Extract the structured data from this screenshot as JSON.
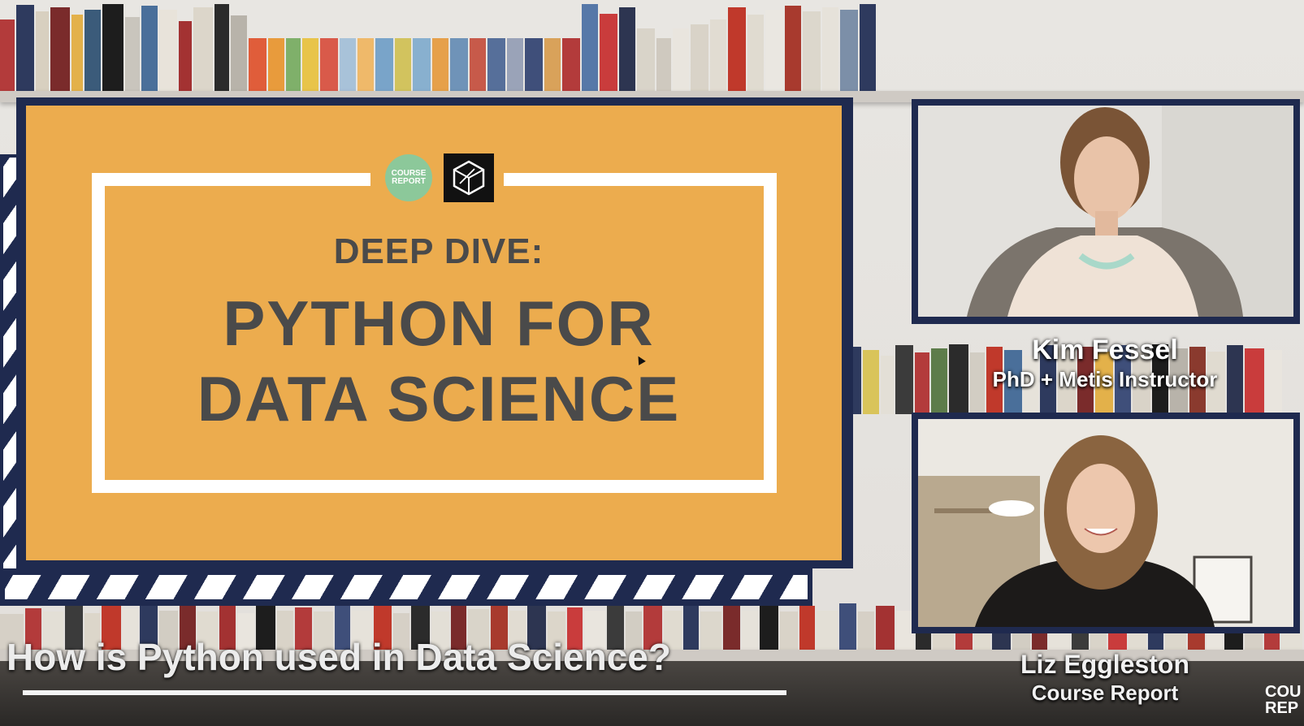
{
  "slide": {
    "logo_course_report": "COURSE REPORT",
    "line1": "DEEP DIVE:",
    "line2": "PYTHON FOR",
    "line3": "DATA SCIENCE"
  },
  "speakers": [
    {
      "name": "Kim Fessel",
      "role": "PhD + Metis Instructor"
    },
    {
      "name": "Liz Eggleston",
      "role": "Course Report"
    }
  ],
  "caption": {
    "question": "How is Python used in Data Science?"
  },
  "corner_logo": {
    "line1": "COU",
    "line2": "REP"
  },
  "colors": {
    "slide_bg": "#ecac4e",
    "navy": "#1f2a4f",
    "text_gray": "#4a4a4a",
    "logo_green": "#8cc89a"
  }
}
